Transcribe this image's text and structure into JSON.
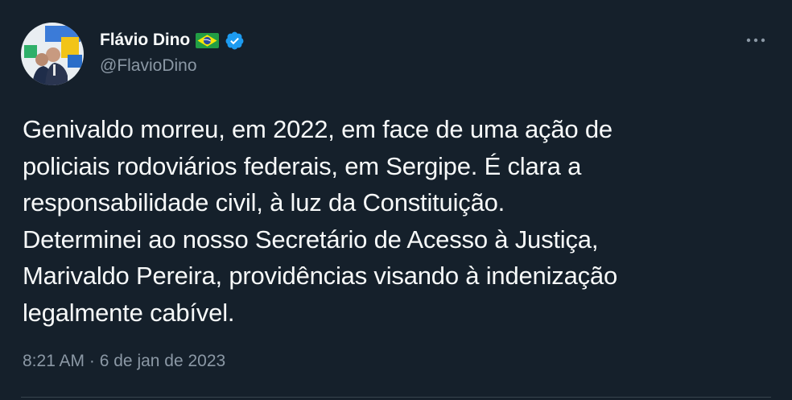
{
  "author": {
    "display_name": "Flávio Dino",
    "handle": "@FlavioDino",
    "flag_icon": "brazil-flag-icon",
    "verified_icon": "verified-badge-icon"
  },
  "more_icon": "more-options-icon",
  "tweet": {
    "text": "Genivaldo morreu, em 2022, em face de uma ação de\npoliciais rodoviários federais, em Sergipe. É clara a\nresponsabilidade civil, à luz da Constituição.\nDeterminei ao nosso Secretário de Acesso à Justiça,\nMarivaldo Pereira, providências visando à indenização\nlegalmente cabível.",
    "time": "8:21 AM",
    "separator": " · ",
    "date": "6 de jan de 2023"
  },
  "colors": {
    "background": "#15202b",
    "text": "#f7f9f9",
    "secondary": "#8b98a5",
    "verified": "#1d9bf0"
  }
}
